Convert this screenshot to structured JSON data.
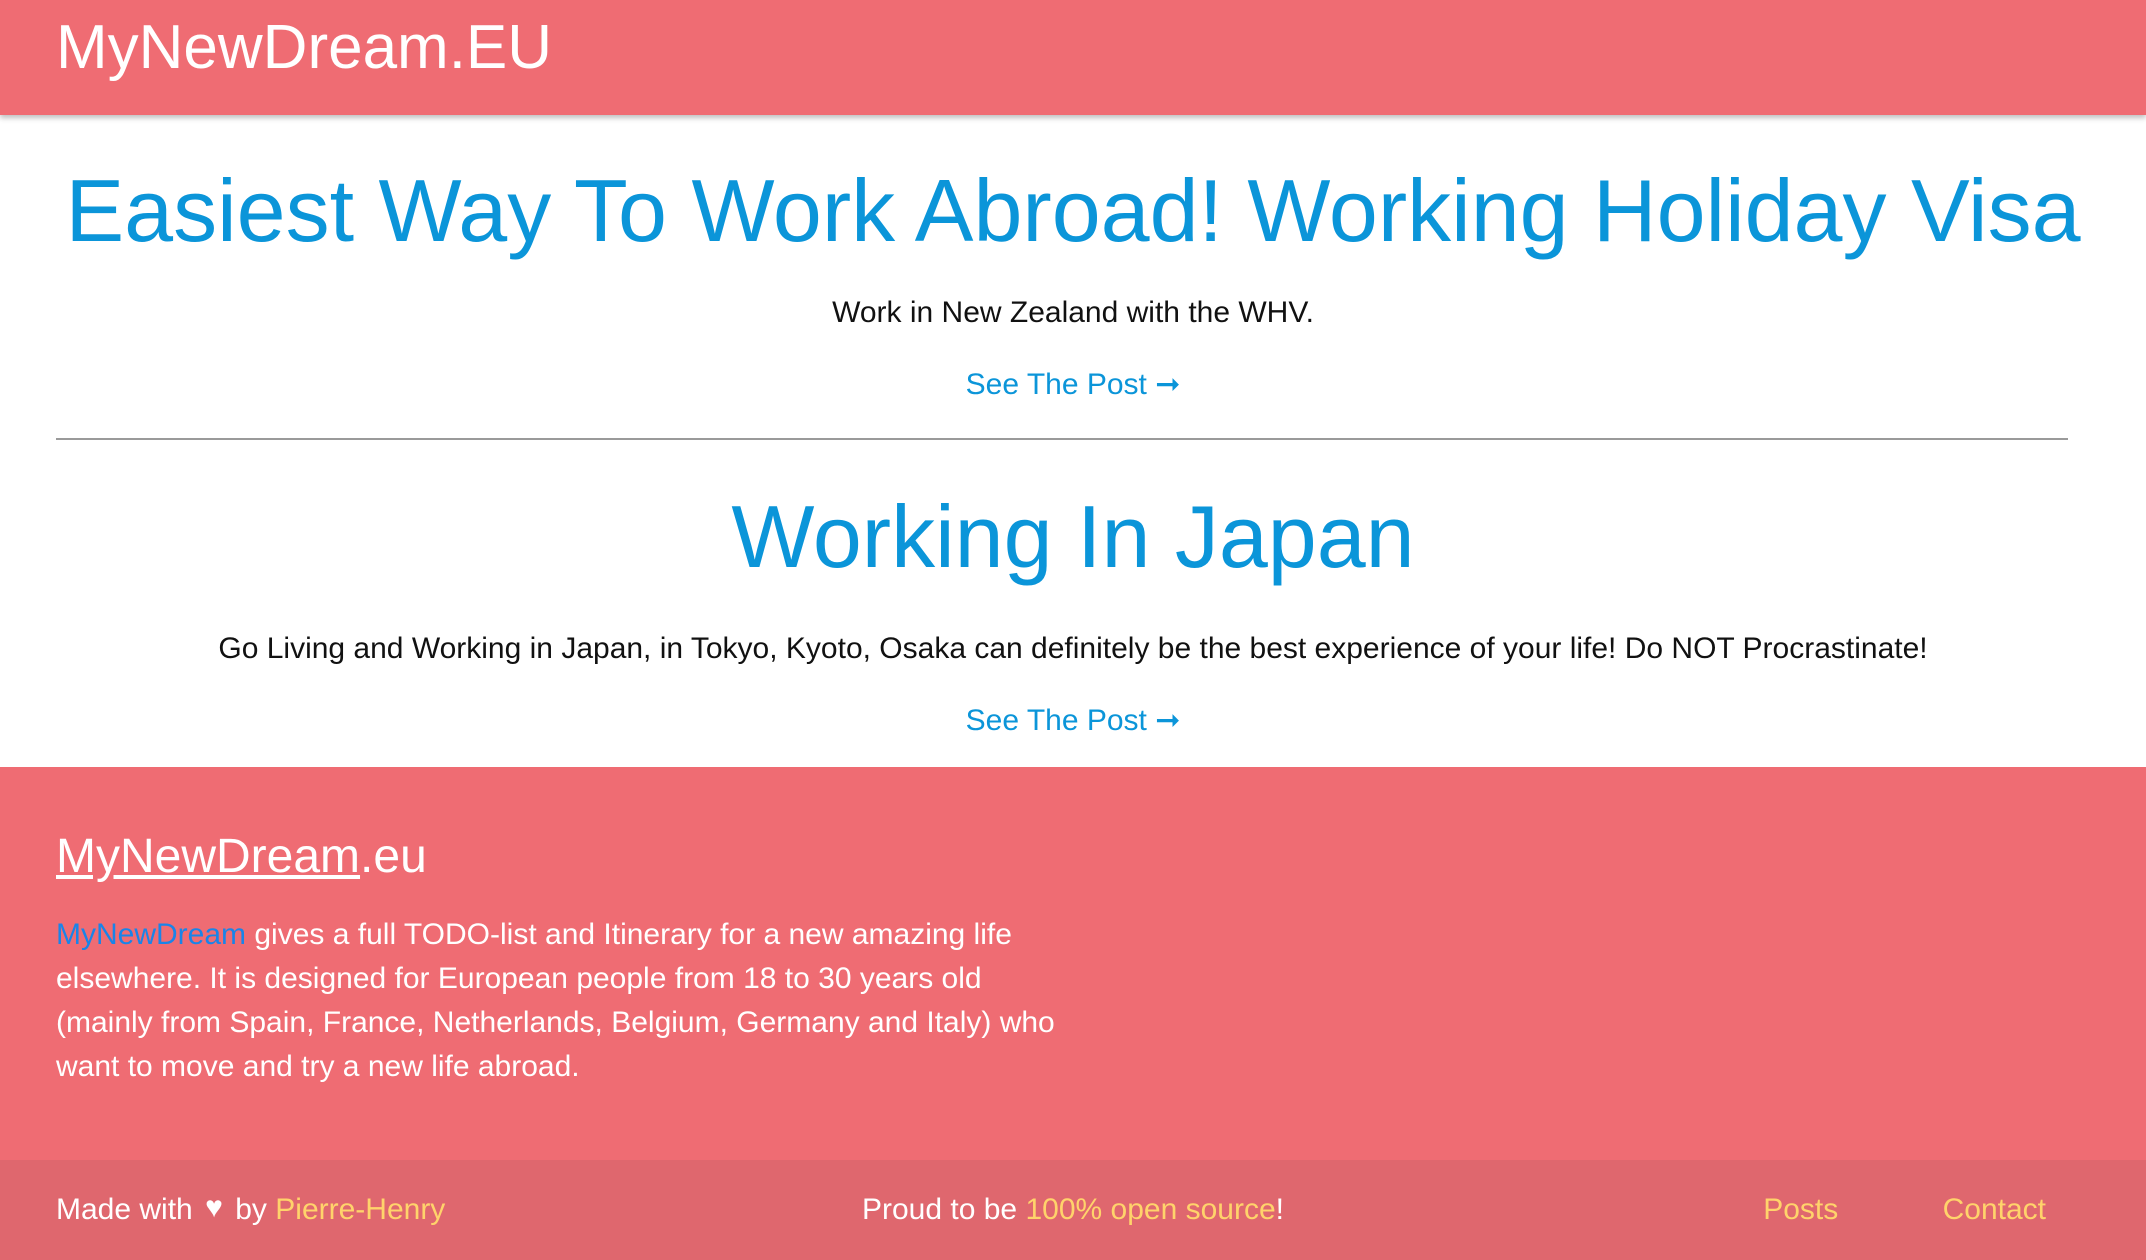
{
  "header": {
    "site_title": "MyNewDream.EU"
  },
  "posts": [
    {
      "title": "Easiest Way To Work Abroad! Working Holiday Visa",
      "excerpt": "Work in New Zealand with the WHV.",
      "link_label": "See The Post ➞"
    },
    {
      "title": "Working In Japan",
      "excerpt": "Go Living and Working in Japan, in Tokyo, Kyoto, Osaka can definitely be the best experience of your life! Do NOT Procrastinate!",
      "link_label": "See The Post ➞"
    }
  ],
  "footer": {
    "brand_link": "MyNewDream",
    "brand_suffix": ".eu",
    "desc_link": "MyNewDream",
    "desc_text": " gives a full TODO-list and Itinerary for a new amazing life elsewhere. It is designed for European people from 18 to 30 years old (mainly from Spain, France, Netherlands, Belgium, Germany and Italy) who want to move and try a new life abroad.",
    "made_with_prefix": "Made with",
    "heart_glyph": "♥",
    "made_with_by": "by",
    "author": "Pierre-Henry",
    "open_source_prefix": "Proud to be ",
    "open_source_link": "100% open source",
    "open_source_suffix": "!",
    "nav": {
      "posts": "Posts",
      "contact": "Contact"
    }
  },
  "colors": {
    "brand_red": "#ef6c73",
    "footer_bar": "#df676e",
    "title_blue": "#0b95d9",
    "link_yellow": "#ffd36b"
  }
}
